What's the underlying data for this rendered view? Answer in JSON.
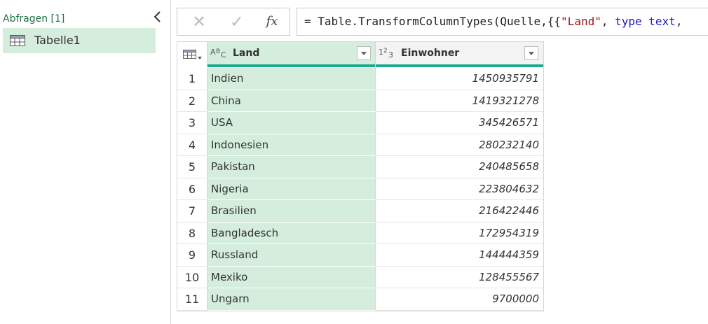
{
  "queries": {
    "header": "Abfragen [1]",
    "items": [
      {
        "label": "Tabelle1",
        "icon": "table-icon"
      }
    ]
  },
  "formula_bar": {
    "cancel_icon": "x-icon",
    "commit_icon": "check-icon",
    "insert_function_label": "fx",
    "formula_prefix": "= Table.TransformColumnTypes(Quelle,{{",
    "formula_string": "\"Land\"",
    "formula_sep": ", ",
    "formula_keyword": "type text",
    "formula_tail": ","
  },
  "table": {
    "columns": [
      {
        "type_label": "ABC",
        "name": "Land"
      },
      {
        "type_label": "123",
        "name": "Einwohner"
      }
    ],
    "rows": [
      {
        "index": "1",
        "land": "Indien",
        "einwohner": "1450935791"
      },
      {
        "index": "2",
        "land": "China",
        "einwohner": "1419321278"
      },
      {
        "index": "3",
        "land": "USA",
        "einwohner": "345426571"
      },
      {
        "index": "4",
        "land": "Indonesien",
        "einwohner": "280232140"
      },
      {
        "index": "5",
        "land": "Pakistan",
        "einwohner": "240485658"
      },
      {
        "index": "6",
        "land": "Nigeria",
        "einwohner": "223804632"
      },
      {
        "index": "7",
        "land": "Brasilien",
        "einwohner": "216422446"
      },
      {
        "index": "8",
        "land": "Bangladesch",
        "einwohner": "172954319"
      },
      {
        "index": "9",
        "land": "Russland",
        "einwohner": "144444359"
      },
      {
        "index": "10",
        "land": "Mexiko",
        "einwohner": "128455567"
      },
      {
        "index": "11",
        "land": "Ungarn",
        "einwohner": "9700000"
      }
    ]
  },
  "colors": {
    "accent_green": "#217346",
    "selected_column": "#d4eddc",
    "quality_bar": "#1aab8a"
  }
}
